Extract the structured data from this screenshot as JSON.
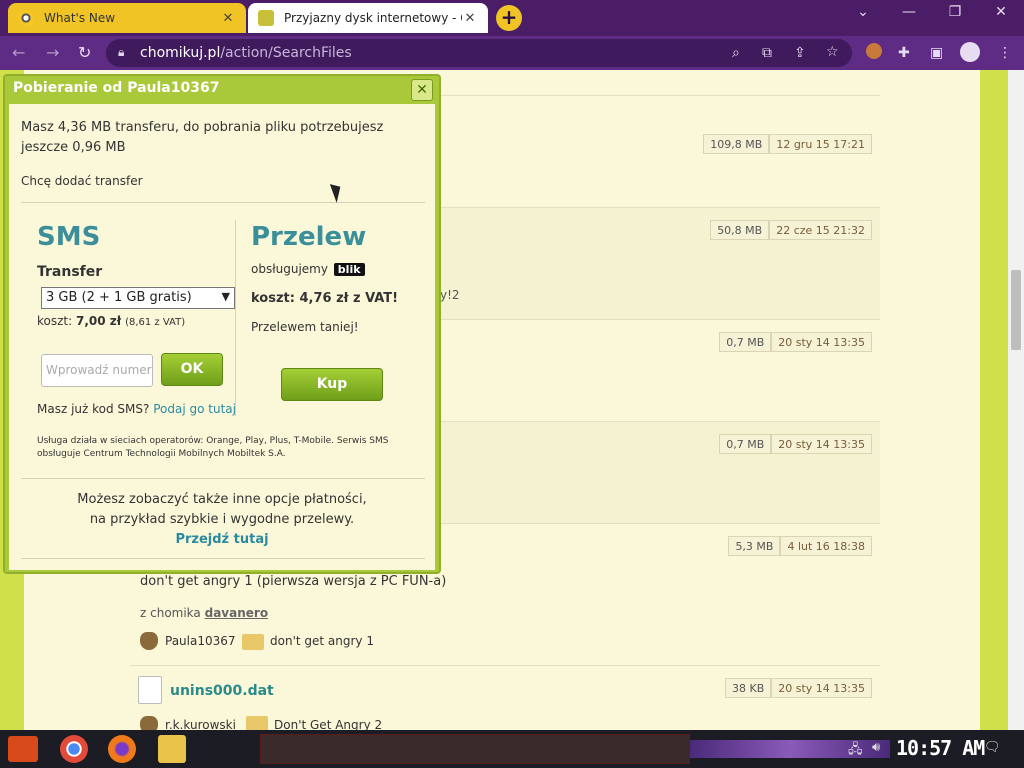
{
  "browser": {
    "tabs": [
      {
        "title": "What's New"
      },
      {
        "title": "Przyjazny dysk internetowy - C"
      }
    ],
    "url_host": "chomikuj.pl",
    "url_path": "/action/SearchFiles",
    "colors": {
      "frame": "#4a1d66",
      "toolbar": "#5e2b85",
      "tab_active": "#f0c425"
    }
  },
  "results": [
    {
      "size": "109,8 MB",
      "date": "12 gru 15 17:21"
    },
    {
      "size": "50,8 MB",
      "date": "22 cze 15 21:32",
      "partial_text": "y!2"
    },
    {
      "size": "0,7 MB",
      "date": "20 sty 14 13:35"
    },
    {
      "size": "0,7 MB",
      "date": "20 sty 14 13:35"
    },
    {
      "size": "5,3 MB",
      "date": "4 lut 16 18:38",
      "description": "don't get angry 1 (pierwsza wersja z PC FUN-a)",
      "from_label": "z chomika",
      "from_user": "davanero",
      "owner": "Paula10367",
      "folder": "don't get angry 1"
    },
    {
      "name": "unins000.dat",
      "size": "38 KB",
      "date": "20 sty 14 13:35",
      "owner": "r.k.kurowski",
      "folder": "Don't Get Angry 2"
    }
  ],
  "modal": {
    "title": "Pobieranie od Paula10367",
    "info_line1": "Masz 4,36 MB transferu, do pobrania pliku potrzebujesz",
    "info_line2": "jeszcze 0,96 MB",
    "add_transfer": "Chcę dodać transfer",
    "sms": {
      "heading": "SMS",
      "transfer_label": "Transfer",
      "selected_option": "3 GB (2 + 1 GB gratis)",
      "cost_prefix": "koszt:",
      "cost_value": "7,00 zł",
      "cost_vat": "(8,61 z VAT)",
      "input_placeholder": "Wprowadź numer",
      "ok_label": "OK",
      "have_code": "Masz już kod SMS?",
      "have_code_link": "Podaj go tutaj",
      "legal_line1": "Usługa działa w sieciach operatorów: Orange, Play, Plus, T-Mobile. Serwis SMS",
      "legal_line2": "obsługuje Centrum Technologii Mobilnych Mobiltek S.A."
    },
    "transfer": {
      "heading": "Przelew",
      "supported_label": "obsługujemy",
      "blik_label": "blik",
      "cost": "koszt: 4,76 zł z VAT!",
      "cheaper": "Przelewem taniej!",
      "buy_label": "Kup"
    },
    "other_line1": "Możesz zobaczyć także inne opcje płatności,",
    "other_line2": "na przykład szybkie i wygodne przelewy.",
    "other_link": "Przejdź tutaj"
  },
  "taskbar": {
    "clock": "10:57 AM"
  }
}
